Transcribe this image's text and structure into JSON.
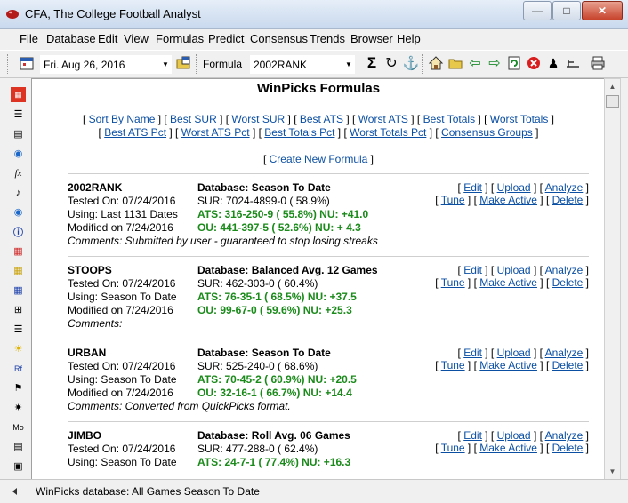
{
  "window": {
    "title": "CFA,  The College Football Analyst"
  },
  "menu": [
    "File",
    "Database",
    "Edit",
    "View",
    "Formulas",
    "Predict",
    "Consensus",
    "Trends",
    "Browser",
    "Help"
  ],
  "toolbar": {
    "date": "Fri. Aug 26, 2016",
    "formula_label": "Formula",
    "formula_value": "2002RANK"
  },
  "page": {
    "title": "WinPicks Formulas",
    "sort_links": [
      "Sort By Name",
      "Best SUR",
      "Worst SUR",
      "Best ATS",
      "Worst ATS",
      "Best Totals",
      "Worst Totals"
    ],
    "pct_links": [
      "Best ATS Pct",
      "Worst ATS Pct",
      "Best Totals Pct",
      "Worst Totals Pct",
      "Consensus Groups"
    ],
    "create_link": "Create New Formula"
  },
  "actions": {
    "edit": "Edit",
    "upload": "Upload",
    "analyze": "Analyze",
    "tune": "Tune",
    "make_active": "Make Active",
    "delete": "Delete"
  },
  "formulas": [
    {
      "name": "2002RANK",
      "tested": "Tested On: 07/24/2016",
      "using": "Using: Last 1131 Dates",
      "modified": "Modified on 7/24/2016",
      "database": "Database: Season To Date",
      "sur": "SUR: 7024-4899-0 ( 58.9%)",
      "ats": "ATS: 316-250-9 ( 55.8%) NU: +41.0",
      "ou": "OU: 441-397-5 ( 52.6%) NU: + 4.3",
      "comments": "Comments: Submitted by user - guaranteed to stop losing streaks"
    },
    {
      "name": "STOOPS",
      "tested": "Tested On: 07/24/2016",
      "using": "Using: Season To Date",
      "modified": "Modified on 7/24/2016",
      "database": "Database: Balanced Avg. 12 Games",
      "sur": "SUR: 462-303-0 ( 60.4%)",
      "ats": "ATS: 76-35-1 ( 68.5%) NU: +37.5",
      "ou": "OU: 99-67-0 ( 59.6%) NU: +25.3",
      "comments": "Comments:"
    },
    {
      "name": "URBAN",
      "tested": "Tested On: 07/24/2016",
      "using": "Using: Season To Date",
      "modified": "Modified on 7/24/2016",
      "database": "Database: Season To Date",
      "sur": "SUR: 525-240-0 ( 68.6%)",
      "ats": "ATS: 70-45-2 ( 60.9%) NU: +20.5",
      "ou": "OU: 32-16-1 ( 66.7%) NU: +14.4",
      "comments": "Comments: Converted from QuickPicks format."
    },
    {
      "name": "JIMBO",
      "tested": "Tested On: 07/24/2016",
      "using": "Using: Season To Date",
      "modified": "",
      "database": "Database: Roll Avg. 06 Games",
      "sur": "SUR: 477-288-0 ( 62.4%)",
      "ats": "ATS: 24-7-1 ( 77.4%) NU: +16.3",
      "ou": "",
      "comments": ""
    }
  ],
  "status": {
    "text": "WinPicks database:  All Games Season To Date"
  }
}
